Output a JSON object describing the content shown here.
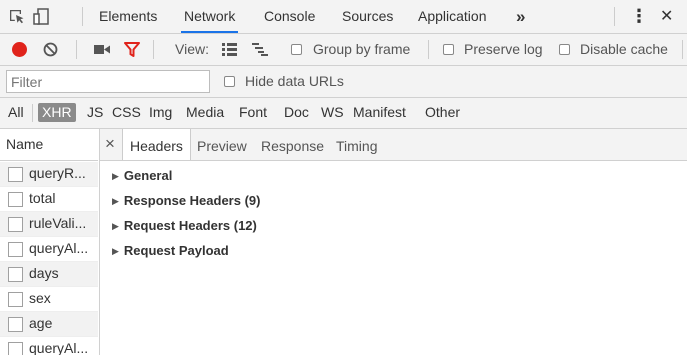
{
  "devtools": {
    "tabs": [
      {
        "label": "Elements"
      },
      {
        "label": "Network"
      },
      {
        "label": "Console"
      },
      {
        "label": "Sources"
      },
      {
        "label": "Application"
      }
    ],
    "more_tabs": "»",
    "menu_icon": "⋮",
    "close_icon": "✕"
  },
  "toolbar": {
    "view_label": "View:",
    "group_by_frame": "Group by frame",
    "preserve_log": "Preserve log",
    "disable_cache": "Disable cache"
  },
  "filter_bar": {
    "placeholder": "Filter",
    "hide_data_urls": "Hide data URLs"
  },
  "type_filters": [
    "All",
    "XHR",
    "JS",
    "CSS",
    "Img",
    "Media",
    "Font",
    "Doc",
    "WS",
    "Manifest",
    "Other"
  ],
  "requests": {
    "header": "Name",
    "items": [
      "queryR...",
      "total",
      "ruleVali...",
      "queryAl...",
      "days",
      "sex",
      "age",
      "queryAl..."
    ]
  },
  "detail": {
    "close": "×",
    "tabs": [
      "Headers",
      "Preview",
      "Response",
      "Timing"
    ],
    "sections": [
      "General",
      "Response Headers (9)",
      "Request Headers (12)",
      "Request Payload"
    ]
  },
  "colors": {
    "record": "#e0231b",
    "filter_active": "#e0231b",
    "xhr_badge": "#8a8a8a",
    "tab_underline": "#1a73e8"
  }
}
